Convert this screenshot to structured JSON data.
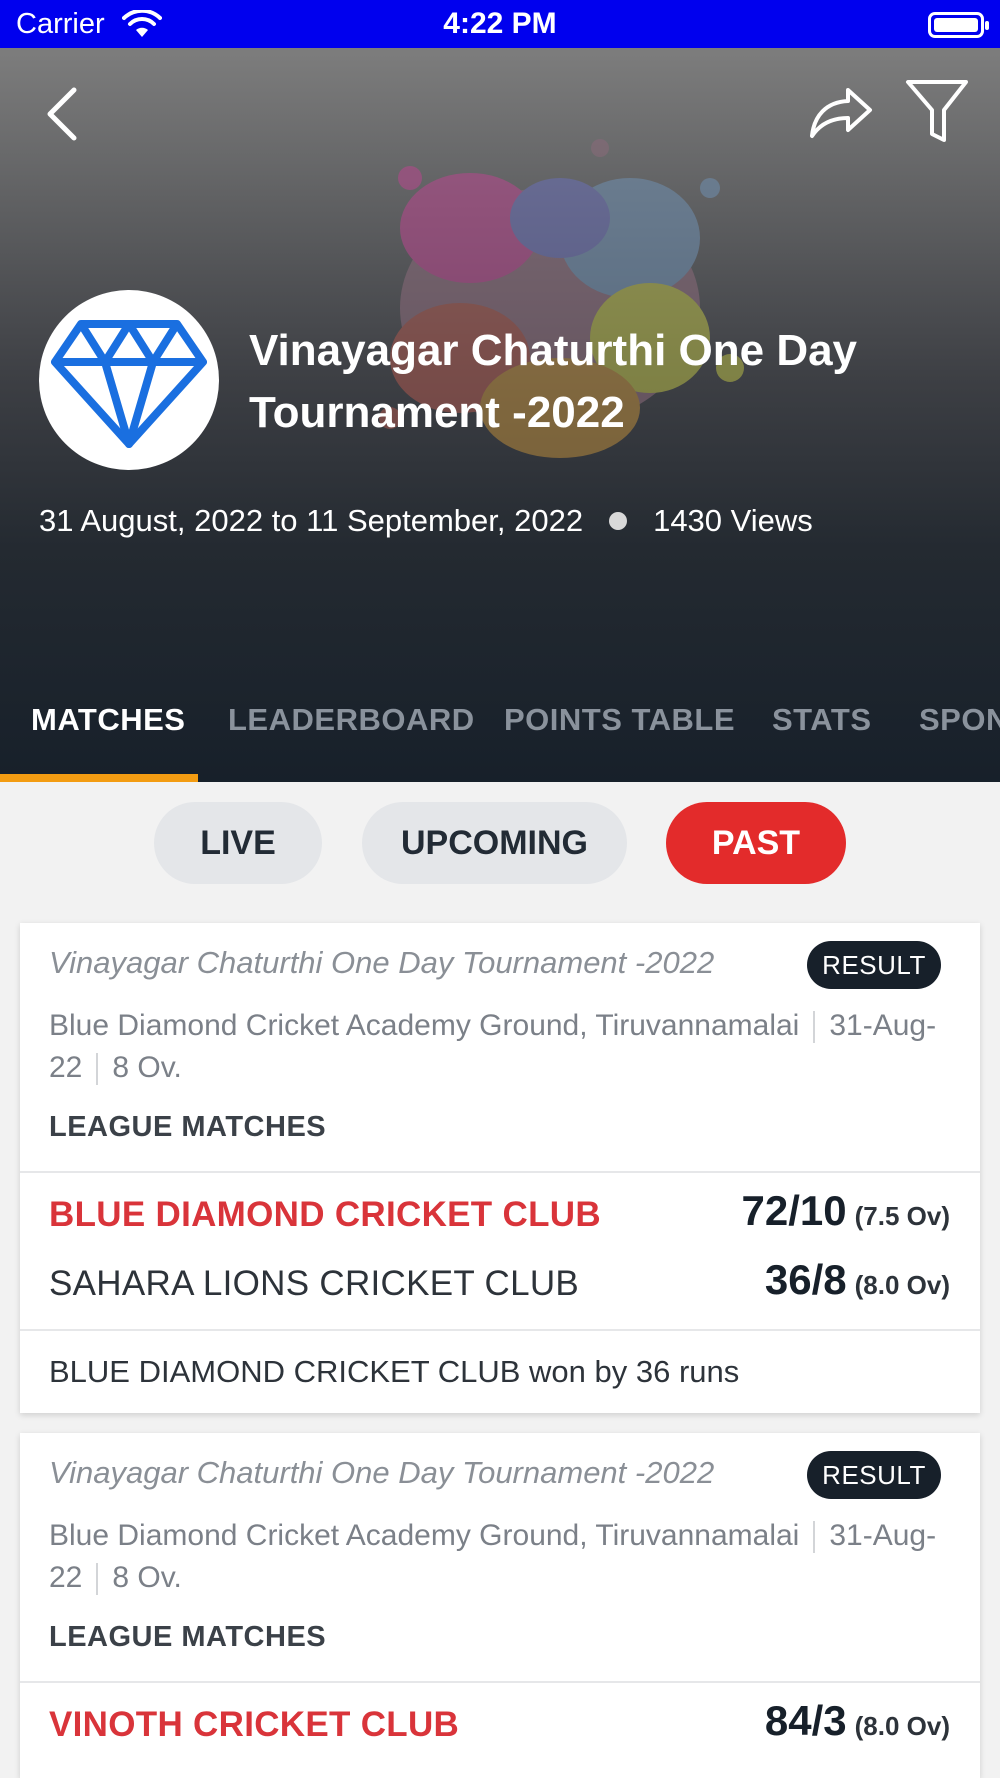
{
  "status_bar": {
    "carrier": "Carrier",
    "time": "4:22 PM"
  },
  "header": {
    "title": "Vinayagar Chaturthi One Day Tournament -2022",
    "dates": "31 August, 2022 to 11 September, 2022",
    "views": "1430 Views"
  },
  "tabs": [
    {
      "label": "MATCHES",
      "active": true
    },
    {
      "label": "LEADERBOARD",
      "active": false
    },
    {
      "label": "POINTS TABLE",
      "active": false
    },
    {
      "label": "STATS",
      "active": false
    },
    {
      "label": "SPON",
      "active": false
    }
  ],
  "segments": [
    {
      "label": "LIVE",
      "active": false
    },
    {
      "label": "UPCOMING",
      "active": false
    },
    {
      "label": "PAST",
      "active": true
    }
  ],
  "matches": [
    {
      "tournament": "Vinayagar Chaturthi One Day Tournament -2022",
      "badge": "RESULT",
      "venue": "Blue Diamond Cricket  Academy Ground, Tiruvannamalai",
      "date": "31-Aug-22",
      "overs": "8 Ov.",
      "stage": "LEAGUE MATCHES",
      "team1": {
        "name": "BLUE DIAMOND CRICKET CLUB",
        "runs": "72/10",
        "overs": "(7.5 Ov)"
      },
      "team2": {
        "name": "SAHARA LIONS CRICKET CLUB",
        "runs": "36/8",
        "overs": "(8.0 Ov)"
      },
      "result": "BLUE DIAMOND CRICKET CLUB won by 36 runs"
    },
    {
      "tournament": "Vinayagar Chaturthi One Day Tournament -2022",
      "badge": "RESULT",
      "venue": "Blue Diamond Cricket  Academy Ground, Tiruvannamalai",
      "date": "31-Aug-22",
      "overs": "8 Ov.",
      "stage": "LEAGUE MATCHES",
      "team1": {
        "name": "VINOTH CRICKET CLUB",
        "runs": "84/3",
        "overs": "(8.0 Ov)"
      }
    }
  ],
  "icons": {
    "back": "chevron-left-icon",
    "share": "share-icon",
    "filter": "filter-icon",
    "logo": "diamond-icon"
  },
  "colors": {
    "status_bar": "#0000ee",
    "accent_tab": "#f39c12",
    "active_segment": "#e32b2b",
    "winner_text": "#d9343a",
    "badge_bg": "#17202a"
  }
}
